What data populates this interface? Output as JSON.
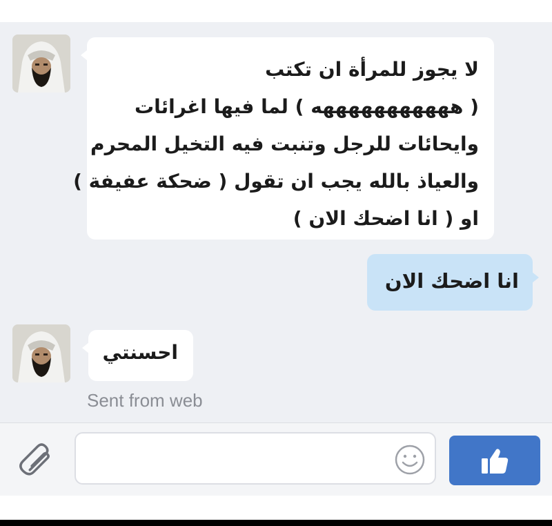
{
  "messages": [
    {
      "direction": "incoming",
      "lines": [
        "لا يجوز للمرأة ان تكتب",
        "( هههههههههههه ) لما فيها اغرائات",
        "وايحائات للرجل وتنبت فيه التخيل المحرم",
        "والعياذ بالله يجب ان تقول ( ضحكة عفيفة )",
        "او ( انا اضحك الان )"
      ]
    },
    {
      "direction": "outgoing",
      "text": "انا اضحك الان"
    },
    {
      "direction": "incoming",
      "text": "احسنتي",
      "meta": "Sent from web"
    }
  ],
  "composer": {
    "input_value": "",
    "attach_icon": "paperclip-icon",
    "emoji_icon": "smiley-icon",
    "like_icon": "thumbs-up-icon"
  },
  "colors": {
    "chat_background": "#eef0f4",
    "incoming_bubble": "#ffffff",
    "outgoing_bubble": "#c9e3f7",
    "like_button": "#4176c8",
    "meta_text": "#8a8d94"
  }
}
